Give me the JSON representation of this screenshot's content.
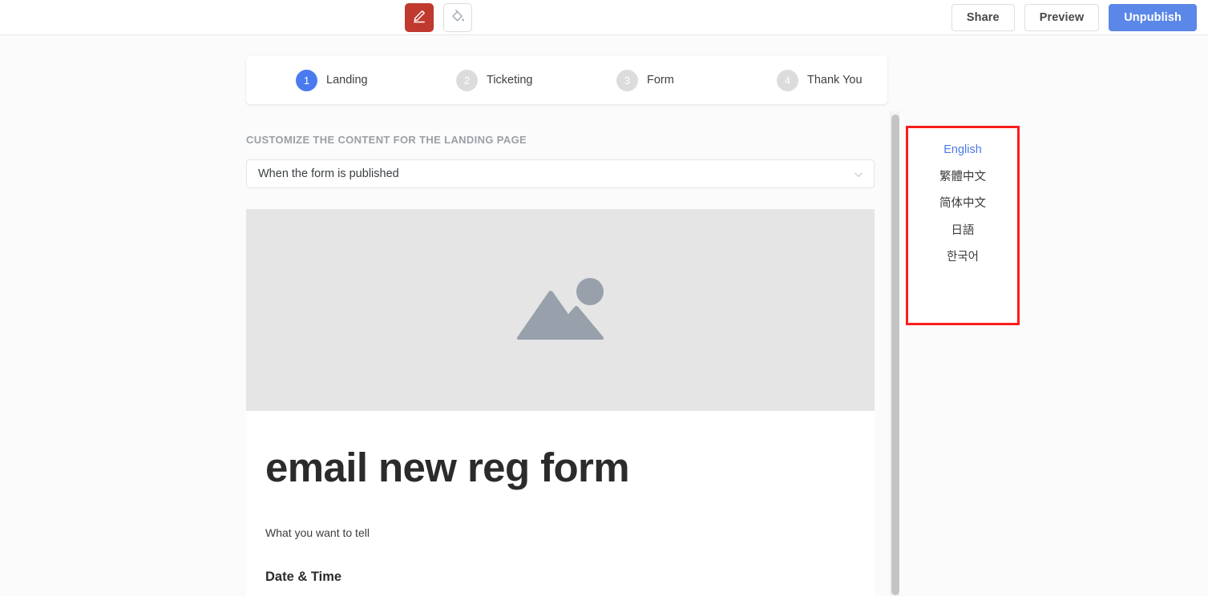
{
  "header": {
    "tools": [
      {
        "name": "edit-pencil-icon",
        "label": "Edit",
        "active": true
      },
      {
        "name": "paint-bucket-icon",
        "label": "Theme",
        "active": false
      }
    ],
    "buttons": {
      "share": "Share",
      "preview": "Preview",
      "unpublish": "Unpublish"
    }
  },
  "steps": [
    {
      "num": "1",
      "label": "Landing",
      "active": true
    },
    {
      "num": "2",
      "label": "Ticketing",
      "active": false
    },
    {
      "num": "3",
      "label": "Form",
      "active": false
    },
    {
      "num": "4",
      "label": "Thank You",
      "active": false
    }
  ],
  "content_section": {
    "label": "CUSTOMIZE THE CONTENT FOR THE LANDING PAGE",
    "select_value": "When the form is published",
    "select_chevron_icon": "chevron-down-icon"
  },
  "preview": {
    "hero_placeholder_icon": "image-placeholder-icon",
    "title": "email new reg form",
    "subtitle": "What you want to tell",
    "section_heading": "Date & Time",
    "detail": ""
  },
  "languages": [
    {
      "label": "English",
      "active": true
    },
    {
      "label": "繁體中文",
      "active": false
    },
    {
      "label": "简体中文",
      "active": false
    },
    {
      "label": "日語",
      "active": false
    },
    {
      "label": "한국어",
      "active": false
    }
  ],
  "colors": {
    "accent_blue": "#5b87e8",
    "step_active": "#4a7bee",
    "edit_red": "#c0392f",
    "highlight_red": "#fc1d1d",
    "placeholder_gray": "#e5e5e5",
    "placeholder_icon": "#97a0ab"
  }
}
